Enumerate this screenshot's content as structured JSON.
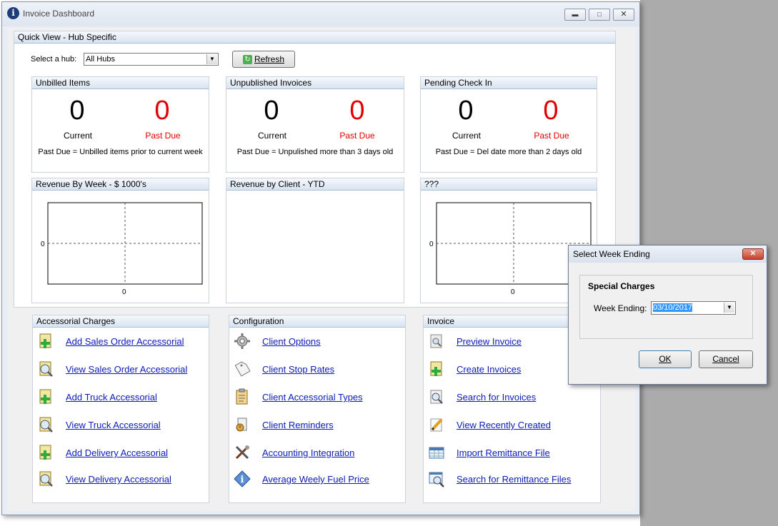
{
  "window": {
    "title": "Invoice Dashboard"
  },
  "quick_view": {
    "header": "Quick View - Hub Specific",
    "hub_label": "Select a hub:",
    "hub_value": "All Hubs",
    "refresh_label": "Refresh"
  },
  "stats": [
    {
      "title": "Unbilled Items",
      "current": "0",
      "current_label": "Current",
      "past_due": "0",
      "past_due_label": "Past Due",
      "note": "Past Due = Unbilled items prior to current week"
    },
    {
      "title": "Unpublished Invoices",
      "current": "0",
      "current_label": "Current",
      "past_due": "0",
      "past_due_label": "Past Due",
      "note": "Past Due = Unpulished more than 3 days old"
    },
    {
      "title": "Pending Check In",
      "current": "0",
      "current_label": "Current",
      "past_due": "0",
      "past_due_label": "Past Due",
      "note": "Past Due = Del date more than 2 days old"
    }
  ],
  "charts": [
    {
      "title": "Revenue By Week - $ 1000's",
      "y_tick": "0",
      "x_tick": "0"
    },
    {
      "title": "Revenue by Client - YTD"
    },
    {
      "title": "???",
      "y_tick": "0",
      "x_tick": "0"
    }
  ],
  "chart_data": [
    {
      "type": "line",
      "title": "Revenue By Week - $ 1000's",
      "x": [],
      "y": [],
      "xticks": [
        "0"
      ],
      "yticks": [
        "0"
      ],
      "grid": true
    },
    {
      "type": "pie",
      "title": "Revenue by Client - YTD",
      "categories": [],
      "values": []
    },
    {
      "type": "line",
      "title": "???",
      "x": [],
      "y": [],
      "xticks": [
        "0"
      ],
      "yticks": [
        "0"
      ],
      "grid": true
    }
  ],
  "accessorial": {
    "header": "Accessorial Charges",
    "items": [
      {
        "label": "Add Sales Order Accessorial",
        "icon": "add-document-icon"
      },
      {
        "label": "View Sales Order Accessorial",
        "icon": "view-document-icon"
      },
      {
        "label": "Add Truck Accessorial",
        "icon": "add-document-icon"
      },
      {
        "label": "View Truck Accessorial",
        "icon": "view-document-icon"
      },
      {
        "label": "Add Delivery Accessorial",
        "icon": "add-document-icon"
      },
      {
        "label": "View Delivery Accessorial",
        "icon": "view-document-icon"
      }
    ]
  },
  "configuration": {
    "header": "Configuration",
    "items": [
      {
        "label": "Client Options",
        "icon": "gear-icon"
      },
      {
        "label": "Client Stop Rates",
        "icon": "tag-icon"
      },
      {
        "label": "Client Accessorial Types",
        "icon": "clipboard-icon"
      },
      {
        "label": "Client Reminders",
        "icon": "reminder-icon"
      },
      {
        "label": "Accounting Integration",
        "icon": "tools-icon"
      },
      {
        "label": "Average Weely Fuel Price",
        "icon": "info-icon"
      }
    ]
  },
  "invoice": {
    "header": "Invoice",
    "items": [
      {
        "label": "Preview Invoice",
        "icon": "preview-icon"
      },
      {
        "label": "Create Invoices",
        "icon": "add-document-icon"
      },
      {
        "label": "Search for Invoices",
        "icon": "search-document-icon"
      },
      {
        "label": "View Recently Created",
        "icon": "pencil-icon"
      },
      {
        "label": "Import Remittance File",
        "icon": "spreadsheet-icon"
      },
      {
        "label": "Search for Remittance Files",
        "icon": "search-spreadsheet-icon"
      }
    ]
  },
  "dialog": {
    "title": "Select Week Ending",
    "group_title": "Special Charges",
    "week_label": "Week Ending:",
    "week_value": "03/10/2017",
    "ok_label": "OK",
    "cancel_label": "Cancel"
  },
  "colors": {
    "link": "#0b1bb5",
    "past_due": "#e00000",
    "header_gradient_top": "#f6f9fd",
    "header_gradient_bottom": "#d8e3f1"
  }
}
